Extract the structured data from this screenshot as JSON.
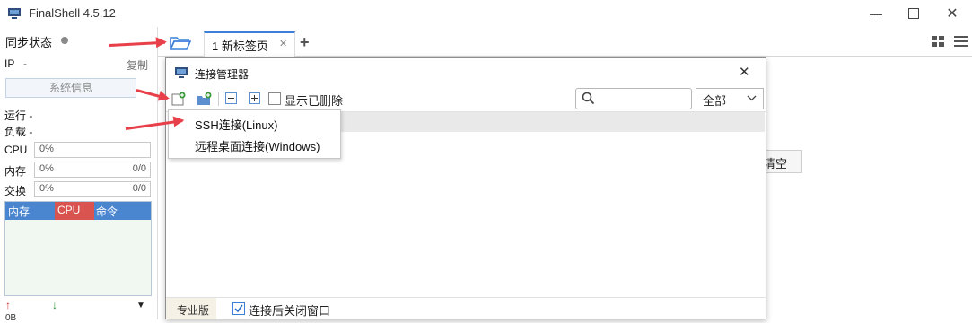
{
  "window": {
    "title": "FinalShell 4.5.12"
  },
  "left_panel": {
    "sync_status": "同步状态",
    "ip_label": "IP",
    "ip_value": "-",
    "copy_label": "复制",
    "sysinfo_button": "系统信息",
    "run_label": "运行 -",
    "load_label": "负载 -",
    "cpu": {
      "label": "CPU",
      "value": "0%"
    },
    "memory": {
      "label": "内存",
      "value": "0%",
      "ratio": "0/0"
    },
    "swap": {
      "label": "交换",
      "value": "0%",
      "ratio": "0/0"
    },
    "tabs": [
      "内存",
      "CPU",
      "命令"
    ],
    "net_label": "0B"
  },
  "tabs": [
    {
      "label": "1 新标签页"
    }
  ],
  "dialog": {
    "title": "连接管理器",
    "show_deleted_label": "显示已删除",
    "search_placeholder": "",
    "filter_value": "全部",
    "clear_button": "清空",
    "footer_edition": "专业版",
    "footer_close_after_connect": "连接后关闭窗口"
  },
  "popup_menu": {
    "items": [
      "SSH连接(Linux)",
      "远程桌面连接(Windows)"
    ]
  },
  "colors": {
    "accent_blue": "#3c7fd9",
    "arrow_red": "#e8404a",
    "tab_cpu_red": "#d9534f",
    "tab_mem_blue": "#4a86d0"
  }
}
